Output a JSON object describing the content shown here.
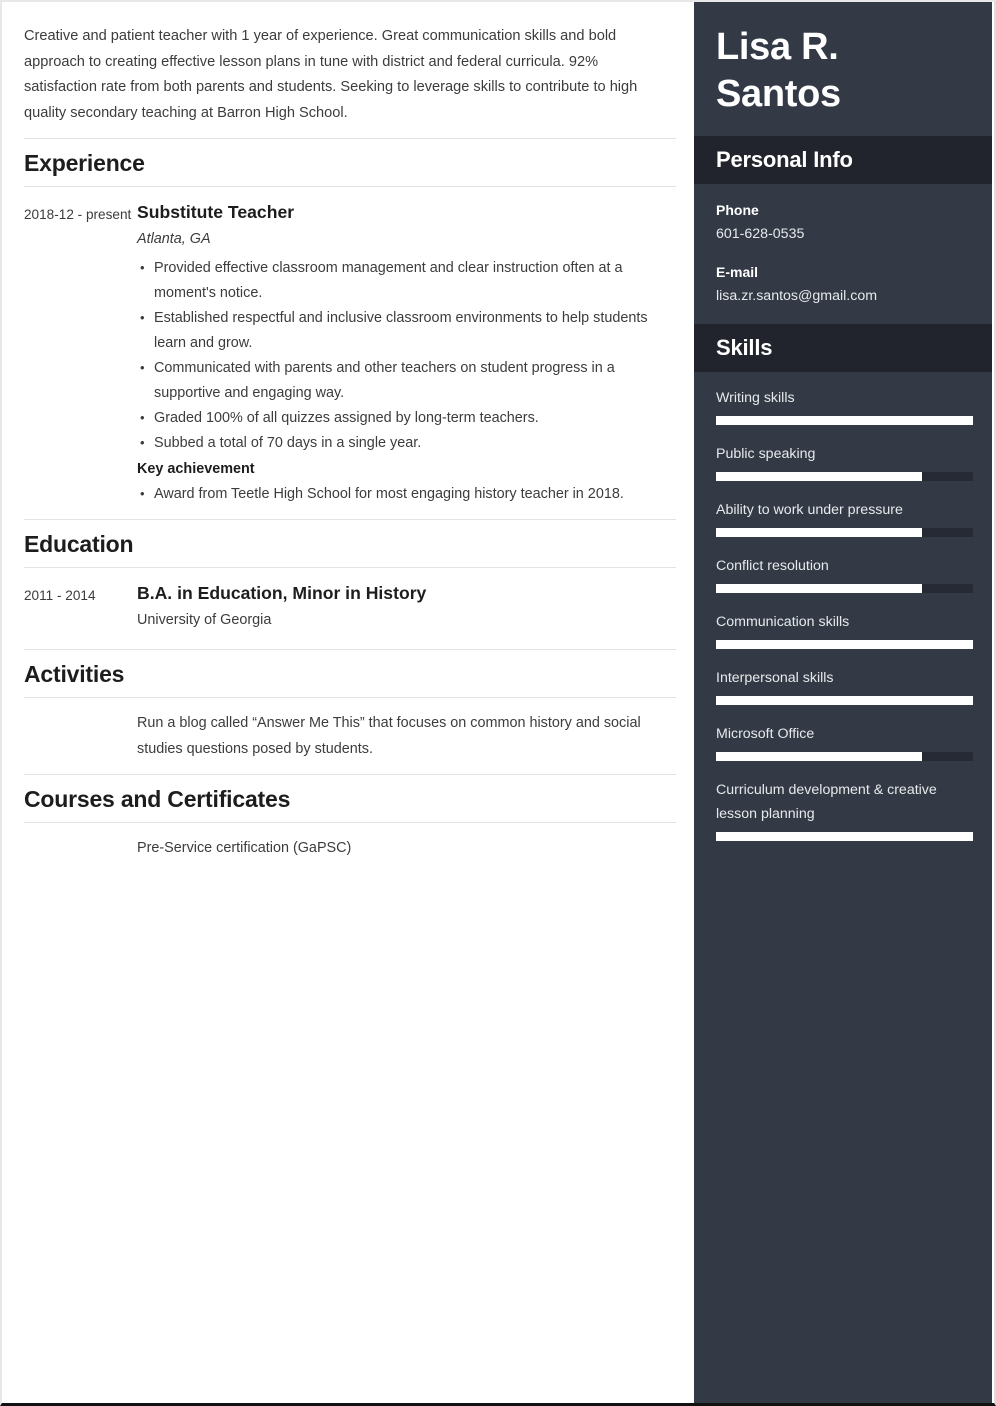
{
  "colors": {
    "sidebar_bg": "#333a45",
    "sidebar_band_bg": "#21242c",
    "skill_fill": "#ffffff",
    "skill_track": "#262a34",
    "text_dark": "#1d1d1d",
    "text_body": "#3c3c3c",
    "divider": "#e3e3e3"
  },
  "summary": {
    "text": "Creative and patient teacher with 1 year of experience. Great communication skills and bold approach to creating effective lesson plans in tune with district and federal curricula. 92% satisfaction rate from both parents and students. Seeking to leverage skills to contribute to high quality secondary teaching at Barron High School."
  },
  "sections": {
    "experience": {
      "heading": "Experience",
      "entry": {
        "dates": "2018-12 - present",
        "title": "Substitute Teacher",
        "location": "Atlanta, GA",
        "bullets": [
          "Provided effective classroom management and clear instruction often at a moment's notice.",
          "Established respectful and inclusive classroom environments to help students learn and grow.",
          "Communicated with parents and other teachers on student progress in a supportive and engaging way.",
          "Graded 100% of all quizzes assigned by long-term teachers.",
          "Subbed a total of 70 days in a single year."
        ],
        "key_achievement_label": "Key achievement",
        "key_achievement_bullets": [
          "Award from Teetle High School for most engaging history teacher in 2018."
        ]
      }
    },
    "education": {
      "heading": "Education",
      "entry": {
        "dates": "2011 - 2014",
        "title": "B.A. in Education, Minor in History",
        "school": "University of Georgia"
      }
    },
    "activities": {
      "heading": "Activities",
      "text": "Run a blog called “Answer Me This” that focuses on common history and social studies questions posed by students."
    },
    "courses": {
      "heading": "Courses and Certificates",
      "text": "Pre-Service certification (GaPSC)"
    }
  },
  "sidebar": {
    "name": "Lisa R. Santos",
    "personal_info": {
      "heading": "Personal Info",
      "fields": [
        {
          "label": "Phone",
          "value": "601-628-0535"
        },
        {
          "label": "E-mail",
          "value": "lisa.zr.santos@gmail.com"
        }
      ]
    },
    "skills": {
      "heading": "Skills",
      "items": [
        {
          "label": "Writing skills",
          "level": 100
        },
        {
          "label": "Public speaking",
          "level": 80
        },
        {
          "label": "Ability to work under pressure",
          "level": 80
        },
        {
          "label": "Conflict resolution",
          "level": 80
        },
        {
          "label": "Communication skills",
          "level": 100
        },
        {
          "label": "Interpersonal skills",
          "level": 100
        },
        {
          "label": "Microsoft Office",
          "level": 80
        },
        {
          "label": "Curriculum development & creative lesson planning",
          "level": 100
        }
      ]
    }
  }
}
